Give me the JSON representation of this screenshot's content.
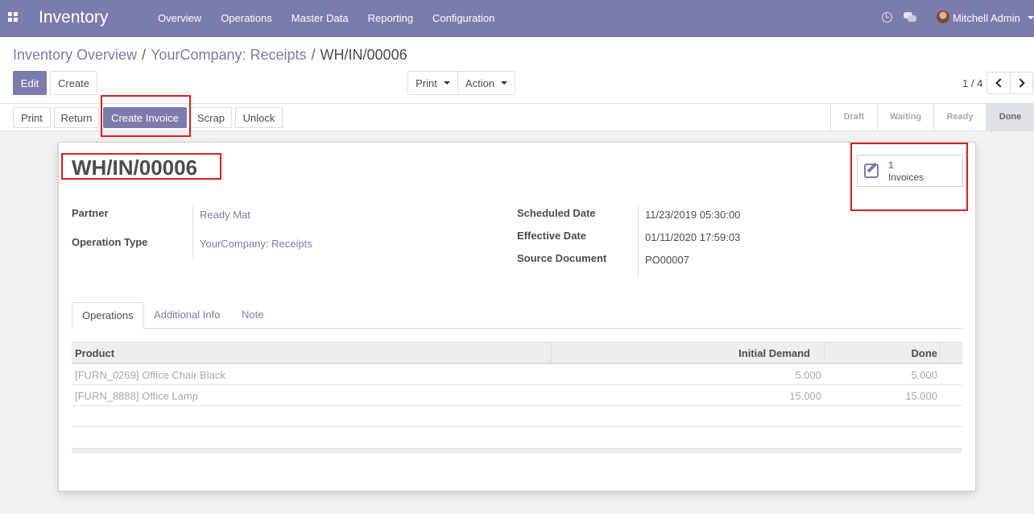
{
  "navbar": {
    "brand": "Inventory",
    "menu": [
      "Overview",
      "Operations",
      "Master Data",
      "Reporting",
      "Configuration"
    ],
    "user_name": "Mitchell Admin",
    "icons": [
      "apps-icon",
      "clock-icon",
      "chat-icon"
    ]
  },
  "breadcrumb": {
    "items": [
      "Inventory Overview",
      "YourCompany: Receipts"
    ],
    "current": "WH/IN/00006",
    "separator": "/"
  },
  "buttons": {
    "edit": "Edit",
    "create": "Create",
    "print": "Print",
    "action": "Action"
  },
  "pager": {
    "value": "1 / 4"
  },
  "header_buttons": {
    "print": "Print",
    "return": "Return",
    "create_invoice": "Create Invoice",
    "scrap": "Scrap",
    "unlock": "Unlock"
  },
  "stages": [
    "Draft",
    "Waiting",
    "Ready",
    "Done"
  ],
  "current_stage": "Done",
  "record": {
    "title": "WH/IN/00006",
    "smart_button": {
      "count": "1",
      "label": "Invoices"
    },
    "fields_left": [
      {
        "label": "Partner",
        "value": "Ready Mat"
      },
      {
        "label": "Operation Type",
        "value": "YourCompany: Receipts"
      }
    ],
    "fields_right": [
      {
        "label": "Scheduled Date",
        "value": "11/23/2019 05:30:00"
      },
      {
        "label": "Effective Date",
        "value": "01/11/2020 17:59:03"
      },
      {
        "label": "Source Document",
        "value": "PO00007"
      }
    ]
  },
  "tabs": [
    "Operations",
    "Additional Info",
    "Note"
  ],
  "table": {
    "columns": [
      "Product",
      "Initial Demand",
      "Done"
    ],
    "rows": [
      [
        "[FURN_0269] Office Chair Black",
        "5.000",
        "5.000"
      ],
      [
        "[FURN_8888] Office Lamp",
        "15.000",
        "15.000"
      ]
    ]
  },
  "colors": {
    "brand": "#7c7bad",
    "highlight": "#d61f1f"
  }
}
